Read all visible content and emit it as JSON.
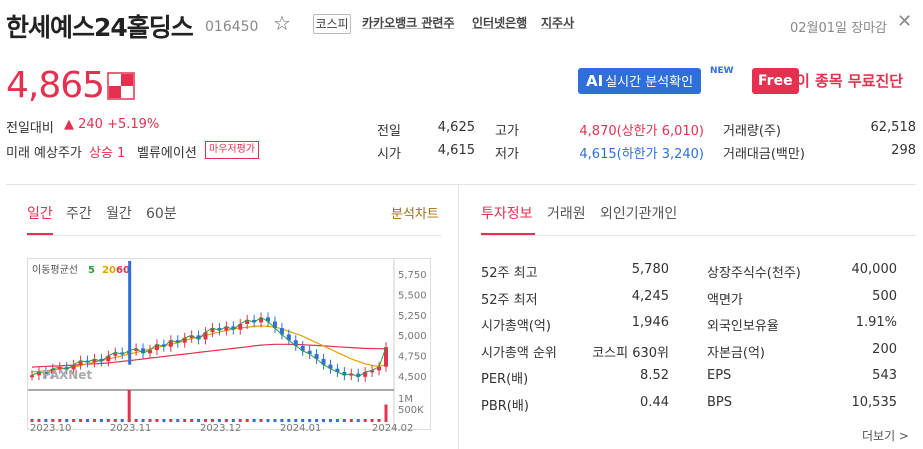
{
  "header": {
    "title": "한세예스24홀딩스",
    "code": "016450",
    "market": "코스피",
    "tags": [
      "카카오뱅크 관련주",
      "인터넷은행",
      "지주사"
    ],
    "market_state": "02월01일 장마감"
  },
  "price": {
    "current": "4,865",
    "change_label": "전일대비",
    "change": "▲ 240 +5.19%",
    "forecast_label": "미래 예상주가",
    "forecast": "상승 1",
    "valuation_label": "벨류에이션",
    "eval_badge": "마우저평가"
  },
  "promo": {
    "ai_prefix": "AI",
    "ai_label": "실시간 분석확인",
    "new_badge": "NEW",
    "free_badge": "Free",
    "free_label": "이 종목 무료진단"
  },
  "quote": {
    "prev_label": "전일",
    "prev": "4,625",
    "open_label": "시가",
    "open": "4,615",
    "high_label": "고가",
    "high": "4,870(상한가 6,010)",
    "low_label": "저가",
    "low": "4,615(하한가 3,240)",
    "volume_label": "거래량(주)",
    "volume": "62,518",
    "amount_label": "거래대금(백만)",
    "amount": "298"
  },
  "chart_tabs": [
    "일간",
    "주간",
    "월간",
    "60분"
  ],
  "chart_analysis": "분석차트",
  "info_tabs": [
    "투자정보",
    "거래원",
    "외인기관개인"
  ],
  "investment": {
    "rows_left": [
      {
        "label": "52주 최고",
        "value": "5,780"
      },
      {
        "label": "52주 최저",
        "value": "4,245"
      },
      {
        "label": "시가총액(억)",
        "value": "1,946"
      },
      {
        "label": "시가총액 순위",
        "value": "코스피 630위"
      },
      {
        "label": "PER(배)",
        "value": "8.52"
      },
      {
        "label": "PBR(배)",
        "value": "0.44"
      }
    ],
    "rows_right": [
      {
        "label": "상장주식수(천주)",
        "value": "40,000"
      },
      {
        "label": "액면가",
        "value": "500"
      },
      {
        "label": "외국인보유율",
        "value": "1.91%"
      },
      {
        "label": "자본금(억)",
        "value": "200"
      },
      {
        "label": "EPS",
        "value": "543"
      },
      {
        "label": "BPS",
        "value": "10,535"
      }
    ],
    "more": "더보기 >"
  },
  "chart_data": {
    "type": "line",
    "title": "",
    "ma_label": "이동평균선",
    "ma_periods": [
      "5",
      "20",
      "60"
    ],
    "ma_colors": [
      "#2a9d3a",
      "#e8a100",
      "#e5304f"
    ],
    "watermark": "PAXNet",
    "price_ticks": [
      "5,750",
      "5,500",
      "5,250",
      "5,000",
      "4,750",
      "4,500"
    ],
    "price_tick_values": [
      5750,
      5500,
      5250,
      5000,
      4750,
      4500
    ],
    "ylim": [
      4400,
      5850
    ],
    "volume_ticks": [
      "1M",
      "500K"
    ],
    "x_ticks": [
      "2023.10",
      "2023.11",
      "2023.12",
      "2024.01",
      "2024.02"
    ],
    "close": [
      4520,
      4560,
      4540,
      4600,
      4620,
      4590,
      4650,
      4700,
      4680,
      4720,
      4690,
      4760,
      4800,
      4780,
      4820,
      4850,
      4790,
      4830,
      4900,
      4870,
      4950,
      4920,
      4980,
      5010,
      4960,
      5050,
      5100,
      5070,
      5120,
      5080,
      5150,
      5200,
      5170,
      5230,
      5180,
      5100,
      5020,
      4950,
      4880,
      4820,
      4780,
      4720,
      4650,
      4600,
      4560,
      4520,
      4540,
      4500,
      4560,
      4580,
      4625,
      4865
    ],
    "ma20": [
      4560,
      4570,
      4575,
      4585,
      4595,
      4605,
      4620,
      4640,
      4660,
      4680,
      4700,
      4720,
      4740,
      4760,
      4780,
      4800,
      4820,
      4840,
      4860,
      4880,
      4900,
      4920,
      4945,
      4970,
      4990,
      5010,
      5030,
      5050,
      5070,
      5090,
      5100,
      5110,
      5120,
      5125,
      5120,
      5110,
      5090,
      5060,
      5030,
      5000,
      4960,
      4920,
      4880,
      4840,
      4800,
      4760,
      4720,
      4690,
      4660,
      4640,
      4630,
      4650
    ],
    "ma60": [
      4620,
      4625,
      4630,
      4632,
      4635,
      4640,
      4645,
      4650,
      4655,
      4660,
      4665,
      4670,
      4680,
      4690,
      4700,
      4710,
      4720,
      4730,
      4740,
      4750,
      4760,
      4770,
      4780,
      4790,
      4800,
      4810,
      4820,
      4830,
      4840,
      4850,
      4860,
      4870,
      4880,
      4890,
      4895,
      4900,
      4900,
      4900,
      4898,
      4895,
      4890,
      4885,
      4880,
      4875,
      4870,
      4865,
      4860,
      4855,
      4850,
      4848,
      4846,
      4845
    ],
    "volume_spikes": [
      {
        "index": 14,
        "value": 1100000
      },
      {
        "index": 51,
        "value": 600000
      }
    ]
  }
}
